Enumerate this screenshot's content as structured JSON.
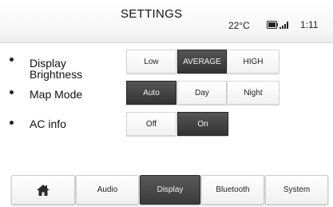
{
  "header": {
    "title": "SETTINGS",
    "temperature": "22°C",
    "phone_status_icon": "phone-battery-signal-icon",
    "time": "1:11"
  },
  "settings": [
    {
      "label_lines": [
        "Display",
        "Brightness"
      ],
      "options": [
        "Low",
        "AVERAGE",
        "HIGH"
      ],
      "selected": "AVERAGE"
    },
    {
      "label_lines": [
        "Map Mode"
      ],
      "options": [
        "Auto",
        "Day",
        "Night"
      ],
      "selected": "Auto"
    },
    {
      "label_lines": [
        "AC info"
      ],
      "options": [
        "Off",
        "On"
      ],
      "selected": "On"
    }
  ],
  "tabs": [
    {
      "icon": "home-icon",
      "label": ""
    },
    {
      "label": "Audio"
    },
    {
      "label": "Display"
    },
    {
      "label": "Bluetooth"
    },
    {
      "label": "System"
    }
  ],
  "selected_tab": "Display",
  "colors": {
    "selected": "#3a3a3a",
    "unselected": "#f4f4f4"
  }
}
